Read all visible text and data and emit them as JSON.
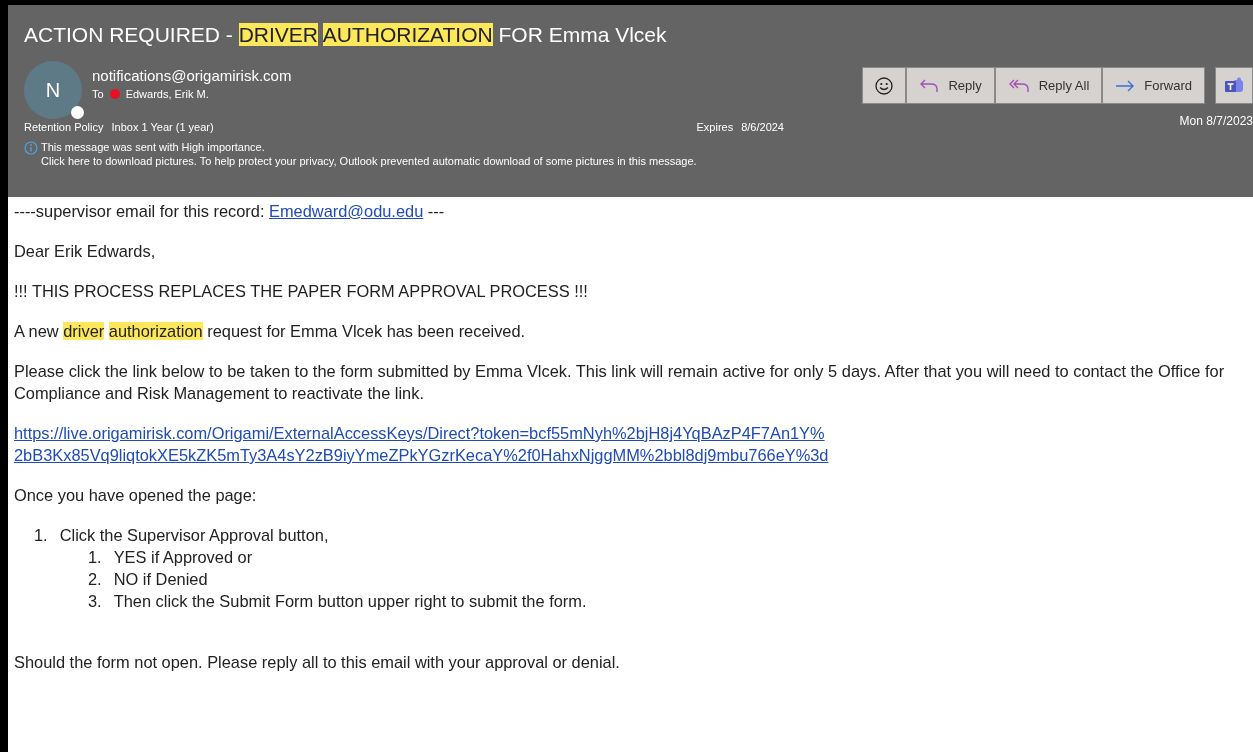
{
  "subject": [
    {
      "text": "ACTION REQUIRED - ",
      "highlighted": false
    },
    {
      "text": "DRIVER",
      "highlighted": true
    },
    {
      "text": "AUTHORIZATION",
      "highlighted": true
    },
    {
      "text": " FOR Emma Vlcek",
      "highlighted": false
    }
  ],
  "sender": {
    "initial": "N",
    "address": "notifications@origamirisk.com",
    "to_label": "To",
    "recipient": "Edwards, Erik M.",
    "busy": true
  },
  "actions": [
    {
      "kind": "emoji"
    },
    {
      "kind": "reply",
      "label": "Reply"
    },
    {
      "kind": "reply_all",
      "label": "Reply All"
    },
    {
      "kind": "forward",
      "label": "Forward"
    },
    {
      "kind": "teams"
    }
  ],
  "date": "Mon 8/7/2023",
  "retention": {
    "label": "Retention Policy",
    "value": "Inbox 1 Year (1 year)",
    "expires_label": "Expires",
    "expires": "8/6/2024"
  },
  "info": [
    "This message was sent with High importance.",
    "Click here to download pictures. To help protect your privacy, Outlook prevented automatic download of some pictures in this message."
  ],
  "body": [
    {
      "kind": "mixed",
      "parts": [
        {
          "text": "----supervisor email for this record: ",
          "link": false
        },
        {
          "text": "Emedward@odu.edu",
          "link": true
        },
        {
          "text": " ---",
          "link": false
        }
      ]
    },
    {
      "kind": "text",
      "lines": [
        "Dear Erik Edwards,"
      ]
    },
    {
      "kind": "text",
      "lines": [
        "!!! THIS PROCESS REPLACES THE PAPER FORM APPROVAL PROCESS !!!"
      ]
    },
    {
      "kind": "highlight",
      "parts": [
        {
          "text": "A new ",
          "highlighted": false
        },
        {
          "text": "driver",
          "highlighted": true
        },
        {
          "text": "authorization",
          "highlighted": true
        },
        {
          "text": " request for Emma Vlcek has been received.",
          "highlighted": false
        }
      ]
    },
    {
      "kind": "text",
      "lines": [
        "Please click the link below to be taken to the form submitted by Emma Vlcek. This link will remain active for only 5 days. After that you will need to contact the Office for",
        "Compliance and Risk Management to reactivate the link."
      ]
    },
    {
      "kind": "link",
      "lines": [
        "https://live.origamirisk.com/Origami/ExternalAccessKeys/Direct?token=bcf55mNyh%2bjH8j4YqBAzP4F7An1Y%",
        "2bB3Kx85Vq9liqtokXE5kZK5mTy3A4sY2zB9iyYmeZPkYGzrKecaY%2f0HahxNjggMM%2bbl8dj9mbu766eY%3d"
      ]
    },
    {
      "kind": "text",
      "lines": [
        "Once you have opened the page:"
      ]
    },
    {
      "kind": "list",
      "items": [
        {
          "number": "1.",
          "text": "Click the Supervisor Approval button,",
          "children": [
            {
              "number": "1.",
              "text": "YES if Approved or"
            },
            {
              "number": "2.",
              "text": "NO if Denied"
            },
            {
              "number": "3.",
              "text": "Then click the Submit Form button upper right to submit the form."
            }
          ]
        }
      ]
    },
    {
      "kind": "text",
      "lines": [
        "Should the form not open. Please reply all to this email with your approval or denial."
      ]
    }
  ]
}
